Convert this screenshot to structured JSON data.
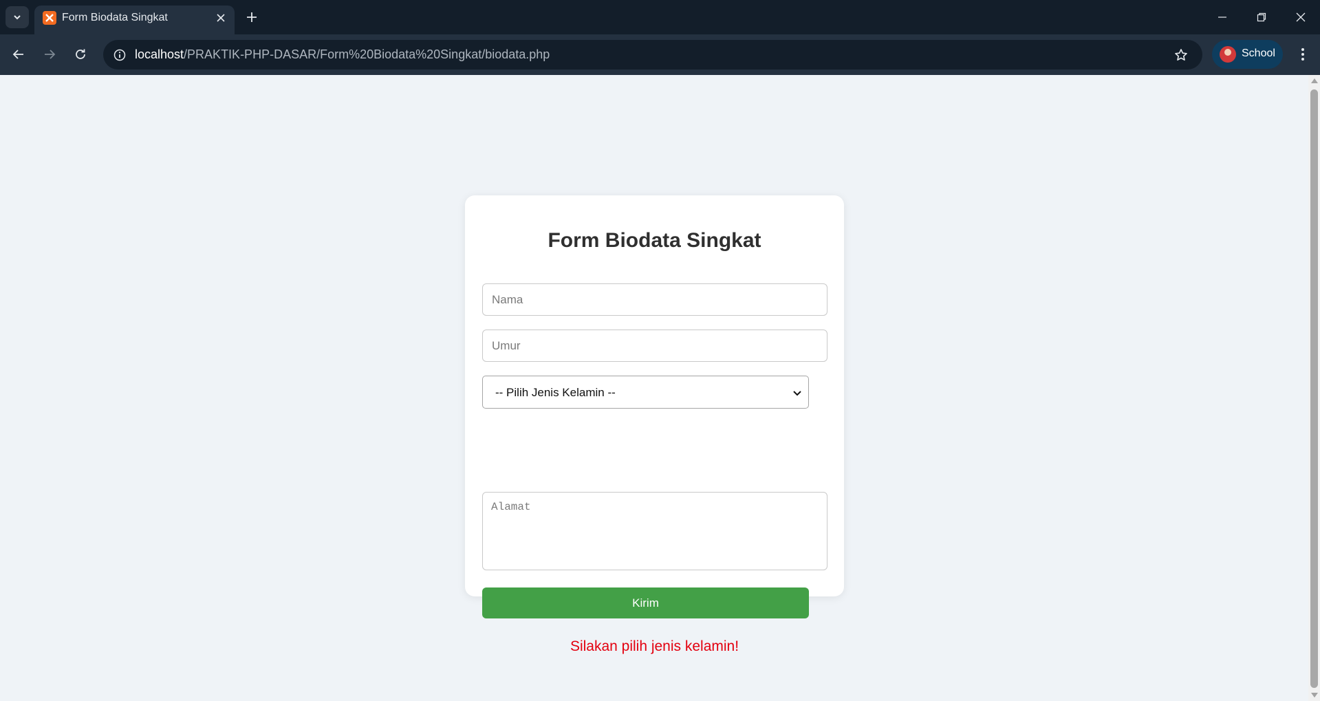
{
  "browser": {
    "tab_title": "Form Biodata Singkat",
    "url_host": "localhost",
    "url_path": "/PRAKTIK-PHP-DASAR/Form%20Biodata%20Singkat/biodata.php",
    "profile_label": "School"
  },
  "form": {
    "title": "Form Biodata Singkat",
    "nama_placeholder": "Nama",
    "umur_placeholder": "Umur",
    "gender_selected": "-- Pilih Jenis Kelamin --",
    "alamat_placeholder": "Alamat",
    "submit_label": "Kirim",
    "error_message": "Silakan pilih jenis kelamin!"
  },
  "colors": {
    "submit_button": "#43a047",
    "error_text": "#e3000f",
    "page_background": "#eff3f7"
  },
  "icons": {
    "tab_list": "chevron-down-icon",
    "favicon": "xampp-icon",
    "tab_close": "close-icon",
    "new_tab": "plus-icon",
    "back": "arrow-left-icon",
    "forward": "arrow-right-icon",
    "reload": "reload-icon",
    "site_info": "info-icon",
    "bookmark": "star-icon",
    "menu": "kebab-menu-icon",
    "select_arrow": "chevron-down-icon"
  }
}
